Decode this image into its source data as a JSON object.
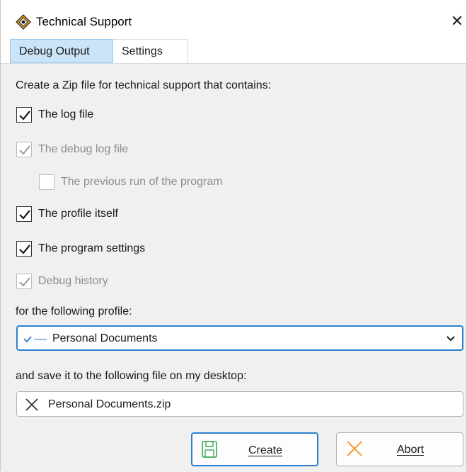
{
  "window": {
    "title": "Technical Support",
    "icon": "app-diamond-icon",
    "close_glyph": "✕"
  },
  "tabs": [
    {
      "label": "Debug Output",
      "active": true
    },
    {
      "label": "Settings",
      "active": false
    }
  ],
  "intro_text": "Create a Zip file for technical support that contains:",
  "options": [
    {
      "label": "The log file",
      "checked": true,
      "enabled": true
    },
    {
      "label": "The debug log file",
      "checked": true,
      "enabled": false
    },
    {
      "label": "The previous run of the program",
      "checked": false,
      "enabled": false
    },
    {
      "label": "The profile itself",
      "checked": true,
      "enabled": true
    },
    {
      "label": "The program settings",
      "checked": true,
      "enabled": true
    },
    {
      "label": "Debug history",
      "checked": true,
      "enabled": false
    }
  ],
  "profile_label": "for the following profile:",
  "profile_select": {
    "value": "Personal Documents",
    "icon": "profile-check-dash-icon"
  },
  "save_label": "and save it to the following file on my desktop:",
  "file_name": {
    "value": "Personal Documents.zip",
    "icon": "x-icon"
  },
  "buttons": {
    "create": {
      "label": "Create",
      "icon": "save-disk-icon"
    },
    "abort": {
      "label": "Abort",
      "icon": "abort-x-icon"
    }
  },
  "colors": {
    "accent": "#2e7fd1",
    "tab_active_bg": "#cce4f7",
    "disabled_text": "#8c8c8c",
    "create_icon_green": "#3aa655",
    "abort_icon_orange": "#f0a030"
  }
}
